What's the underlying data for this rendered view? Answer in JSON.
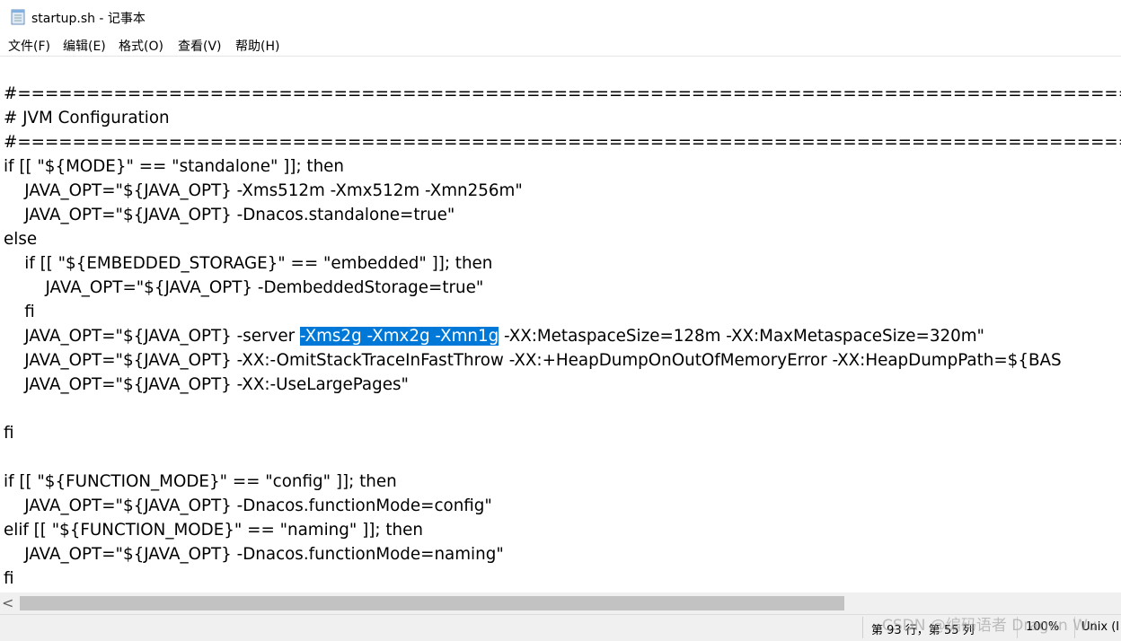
{
  "window": {
    "title": "startup.sh - 记事本",
    "icon": "notepad-icon"
  },
  "menu": [
    {
      "label": "文件(F)"
    },
    {
      "label": "编辑(E)"
    },
    {
      "label": "格式(O)"
    },
    {
      "label": "查看(V)"
    },
    {
      "label": "帮助(H)"
    }
  ],
  "editor": {
    "lines": [
      "#=============================================================================================",
      "# JVM Configuration",
      "#=============================================================================================",
      "if [[ \"${MODE}\" == \"standalone\" ]]; then",
      "    JAVA_OPT=\"${JAVA_OPT} -Xms512m -Xmx512m -Xmn256m\"",
      "    JAVA_OPT=\"${JAVA_OPT} -Dnacos.standalone=true\"",
      "else",
      "    if [[ \"${EMBEDDED_STORAGE}\" == \"embedded\" ]]; then",
      "        JAVA_OPT=\"${JAVA_OPT} -DembeddedStorage=true\"",
      "    fi",
      {
        "before": "    JAVA_OPT=\"${JAVA_OPT} -server ",
        "selected": "-Xms2g -Xmx2g -Xmn1g",
        "after": " -XX:MetaspaceSize=128m -XX:MaxMetaspaceSize=320m\""
      },
      "    JAVA_OPT=\"${JAVA_OPT} -XX:-OmitStackTraceInFastThrow -XX:+HeapDumpOnOutOfMemoryError -XX:HeapDumpPath=${BAS",
      "    JAVA_OPT=\"${JAVA_OPT} -XX:-UseLargePages\"",
      "",
      "fi",
      "",
      "if [[ \"${FUNCTION_MODE}\" == \"config\" ]]; then",
      "    JAVA_OPT=\"${JAVA_OPT} -Dnacos.functionMode=config\"",
      "elif [[ \"${FUNCTION_MODE}\" == \"naming\" ]]; then",
      "    JAVA_OPT=\"${JAVA_OPT} -Dnacos.functionMode=naming\"",
      "fi"
    ],
    "selection_color": "#0078d7"
  },
  "scrollbar": {
    "left_arrow": "<"
  },
  "status": {
    "position": "第 93 行，第 55 列",
    "zoom": "100%",
    "line_ending": "Unix (I"
  },
  "watermark": "CSDN @编码语者 Dragon Wu"
}
